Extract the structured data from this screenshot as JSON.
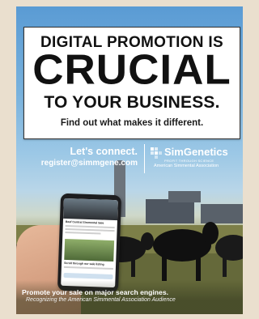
{
  "headline": {
    "line1": "DIGITAL PROMOTION IS",
    "line2": "CRUCIAL",
    "line3": "TO YOUR BUSINESS.",
    "subline": "Find out what makes it different."
  },
  "contact": {
    "line1": "Let's connect.",
    "line2": "register@simmgene.com"
  },
  "brand": {
    "icon": "simgenetics-logo-icon",
    "name": "SimGenetics",
    "tagline": "PROFIT THROUGH SCIENCE",
    "subtitle": "American Simmental Association"
  },
  "phone_screen": {
    "title": "Beef Central Simmental Sale",
    "title2": "Scroll through our sale listing"
  },
  "footer": {
    "line1": "Promote your sale on major search engines.",
    "line2": "Recognizing the American Simmental Association Audience"
  },
  "colors": {
    "sky": "#79b2dd",
    "pasture": "#8d8f56",
    "frame": "#eadfce"
  }
}
